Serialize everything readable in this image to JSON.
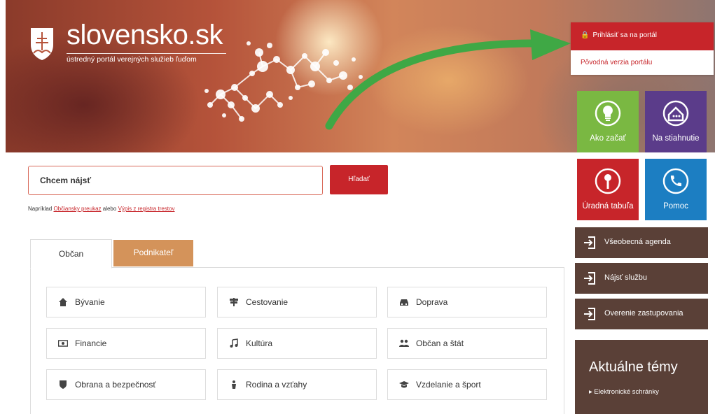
{
  "header": {
    "logo_title": "slovensko.sk",
    "logo_subtitle": "ústredný portál verejných služieb ľuďom"
  },
  "login": {
    "login_label": "Prihlásiť sa na portál",
    "old_version_label": "Pôvodná verzia portálu"
  },
  "tiles": [
    {
      "label": "Ako začať",
      "color": "#7ab842",
      "icon": "lightbulb-icon"
    },
    {
      "label": "Na stiahnutie",
      "color": "#5b3c8a",
      "icon": "download-house-icon"
    },
    {
      "label": "Úradná tabuľa",
      "color": "#c7252a",
      "icon": "pin-icon"
    },
    {
      "label": "Pomoc",
      "color": "#1c7ec2",
      "icon": "phone-icon"
    }
  ],
  "side_buttons": [
    {
      "label": "Všeobecná agenda",
      "icon": "login-arrow-icon"
    },
    {
      "label": "Nájsť službu",
      "icon": "login-arrow-icon"
    },
    {
      "label": "Overenie zastupovania",
      "icon": "login-arrow-icon"
    }
  ],
  "topics": {
    "title": "Aktuálne témy",
    "items": [
      "Elektronické schránky"
    ]
  },
  "search": {
    "placeholder": "Chcem nájsť",
    "button_label": "Hľadať",
    "example_prefix": "Napríklad",
    "example_link1": "Občiansky preukaz",
    "example_middle": "alebo",
    "example_link2": "Výpis z registra trestov"
  },
  "tabs": [
    {
      "label": "Občan",
      "active": true
    },
    {
      "label": "Podnikateľ",
      "active": false
    }
  ],
  "categories": [
    {
      "label": "Bývanie",
      "icon": "home-icon"
    },
    {
      "label": "Cestovanie",
      "icon": "signpost-icon"
    },
    {
      "label": "Doprava",
      "icon": "car-icon"
    },
    {
      "label": "Financie",
      "icon": "money-icon"
    },
    {
      "label": "Kultúra",
      "icon": "music-icon"
    },
    {
      "label": "Občan a štát",
      "icon": "people-icon"
    },
    {
      "label": "Obrana a bezpečnosť",
      "icon": "shield-icon"
    },
    {
      "label": "Rodina a vzťahy",
      "icon": "family-icon"
    },
    {
      "label": "Vzdelanie a šport",
      "icon": "graduation-cap-icon"
    }
  ],
  "colors": {
    "brand_red": "#c7252a",
    "brown": "#5a4037",
    "tab_orange": "#d4935a",
    "arrow_green": "#3fa845"
  }
}
